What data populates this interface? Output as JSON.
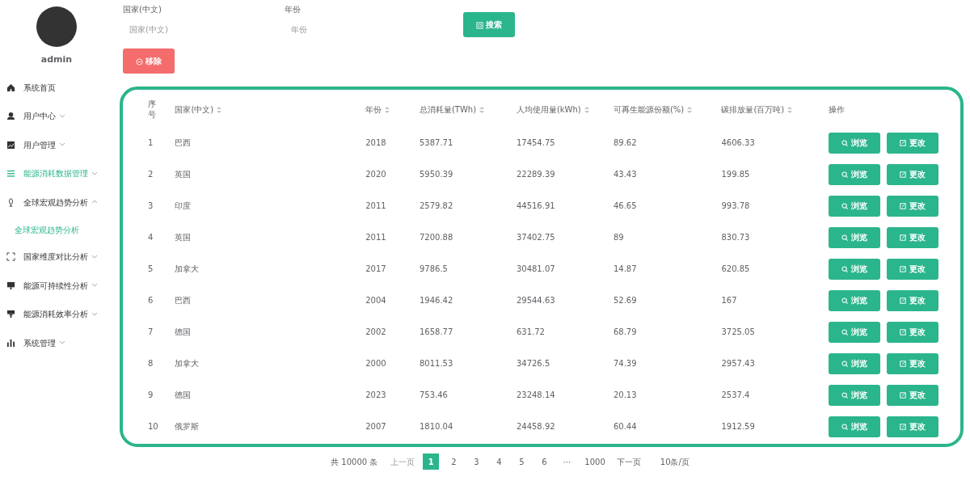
{
  "user": {
    "name": "admin"
  },
  "sidebar": {
    "items": [
      {
        "kind": "home",
        "label": "系统首页",
        "selected": false
      },
      {
        "kind": "user",
        "label": "用户中心",
        "selected": false,
        "expanded": false
      },
      {
        "kind": "chart",
        "label": "用户管理",
        "selected": false,
        "expanded": false
      },
      {
        "kind": "list",
        "label": "能源消耗数据管理",
        "selected": true,
        "expanded": false
      },
      {
        "kind": "mic",
        "label": "全球宏观趋势分析",
        "selected": false,
        "expanded": true,
        "children": [
          {
            "label": "全球宏观趋势分析",
            "selected": true
          }
        ]
      },
      {
        "kind": "frame",
        "label": "国家维度对比分析",
        "selected": false,
        "expanded": false
      },
      {
        "kind": "monitor",
        "label": "能源可持续性分析",
        "selected": false,
        "expanded": false
      },
      {
        "kind": "plug",
        "label": "能源消耗效率分析",
        "selected": false,
        "expanded": false
      },
      {
        "kind": "bars",
        "label": "系统管理",
        "selected": false,
        "expanded": false
      }
    ]
  },
  "search": {
    "fields": [
      {
        "label": "国家(中文)",
        "placeholder": "国家(中文)"
      },
      {
        "label": "年份",
        "placeholder": "年份"
      }
    ],
    "search_button": "搜索",
    "remove_button": "移除"
  },
  "table": {
    "columns": [
      {
        "label": "序号",
        "sortable": false
      },
      {
        "label": "国家(中文)",
        "sortable": true
      },
      {
        "label": "年份",
        "sortable": true
      },
      {
        "label": "总消耗量(TWh)",
        "sortable": true
      },
      {
        "label": "人均使用量(kWh)",
        "sortable": true
      },
      {
        "label": "可再生能源份额(%)",
        "sortable": true
      },
      {
        "label": "碳排放量(百万吨)",
        "sortable": true
      },
      {
        "label": "操作",
        "sortable": false
      }
    ],
    "rows": [
      {
        "cells": [
          "1",
          "巴西",
          "2018",
          "5387.71",
          "17454.75",
          "89.62",
          "4606.33"
        ],
        "actions": [
          "浏览",
          "更改"
        ]
      },
      {
        "cells": [
          "2",
          "英国",
          "2020",
          "5950.39",
          "22289.39",
          "43.43",
          "199.85"
        ],
        "actions": [
          "浏览",
          "更改"
        ]
      },
      {
        "cells": [
          "3",
          "印度",
          "2011",
          "2579.82",
          "44516.91",
          "46.65",
          "993.78"
        ],
        "actions": [
          "浏览",
          "更改"
        ]
      },
      {
        "cells": [
          "4",
          "英国",
          "2011",
          "7200.88",
          "37402.75",
          "89",
          "830.73"
        ],
        "actions": [
          "浏览",
          "更改"
        ]
      },
      {
        "cells": [
          "5",
          "加拿大",
          "2017",
          "9786.5",
          "30481.07",
          "14.87",
          "620.85"
        ],
        "actions": [
          "浏览",
          "更改"
        ]
      },
      {
        "cells": [
          "6",
          "巴西",
          "2004",
          "1946.42",
          "29544.63",
          "52.69",
          "167"
        ],
        "actions": [
          "浏览",
          "更改"
        ]
      },
      {
        "cells": [
          "7",
          "德国",
          "2002",
          "1658.77",
          "631.72",
          "68.79",
          "3725.05"
        ],
        "actions": [
          "浏览",
          "更改"
        ]
      },
      {
        "cells": [
          "8",
          "加拿大",
          "2000",
          "8011.53",
          "34726.5",
          "74.39",
          "2957.43"
        ],
        "actions": [
          "浏览",
          "更改"
        ]
      },
      {
        "cells": [
          "9",
          "德国",
          "2023",
          "753.46",
          "23248.14",
          "20.13",
          "2537.4"
        ],
        "actions": [
          "浏览",
          "更改"
        ]
      },
      {
        "cells": [
          "10",
          "俄罗斯",
          "2007",
          "1810.04",
          "24458.92",
          "60.44",
          "1912.59"
        ],
        "actions": [
          "浏览",
          "更改"
        ]
      }
    ]
  },
  "pagination": {
    "total": "共 10000 条",
    "prev": "上一页",
    "prev_disabled": true,
    "pages": [
      {
        "label": "1",
        "selected": true
      },
      {
        "label": "2",
        "selected": false
      },
      {
        "label": "3",
        "selected": false
      },
      {
        "label": "4",
        "selected": false
      },
      {
        "label": "5",
        "selected": false
      },
      {
        "label": "6",
        "selected": false
      },
      {
        "label": "···",
        "selected": false
      },
      {
        "label": "1000",
        "selected": false
      }
    ],
    "next": "下一页",
    "page_size": "10条/页"
  }
}
